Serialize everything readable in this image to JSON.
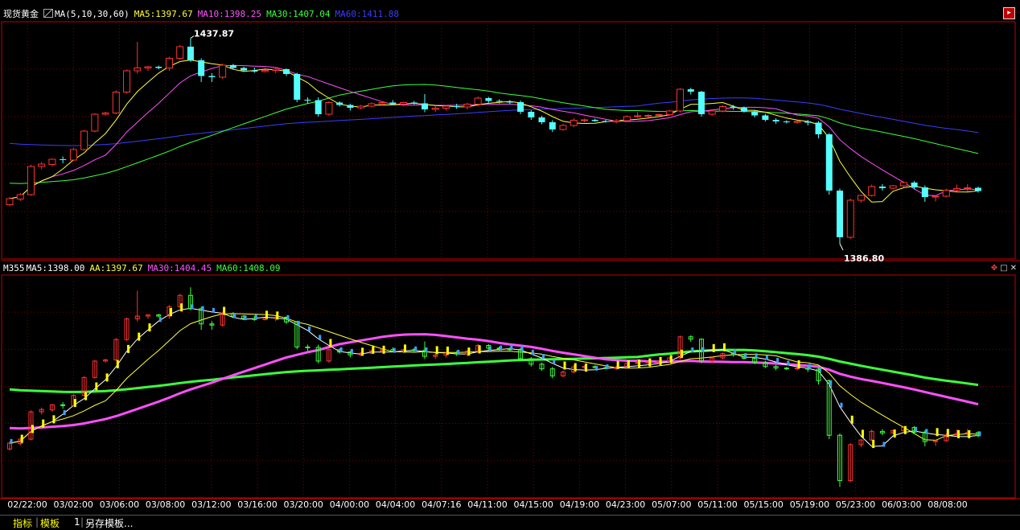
{
  "header": {
    "symbol": "现货黄金",
    "indicator": "MA(5,10,30,60)",
    "ma5": "MA5:1397.67",
    "ma10": "MA10:1398.25",
    "ma30": "MA30:1407.04",
    "ma60": "MA60:1411.88"
  },
  "sub_header": {
    "name": "M355",
    "ma5": "MA5:1398.00",
    "aa": "AA:1397.67",
    "ma30": "MA30:1404.45",
    "ma60": "MA60:1408.09"
  },
  "bottom_bar": {
    "tab1": "指标",
    "tab2": "模板",
    "num": "1",
    "save": "另存模板..."
  },
  "colors": {
    "up": "#ff3232",
    "down": "#54ffff",
    "ma5": "#ffff3c",
    "ma10": "#ff50ff",
    "ma30": "#3cff3c",
    "ma60": "#3c3cff",
    "grid": "#800000",
    "axis": "#c00000"
  },
  "chart_data": [
    {
      "type": "candlestick",
      "title": "",
      "annotations": [
        {
          "label": "1437.87",
          "value": 1437.87
        },
        {
          "label": "1386.80",
          "value": 1386.8
        }
      ],
      "x_ticks": [
        "02/22:00",
        "03/02:00",
        "03/06:00",
        "03/08:00",
        "03/12:00",
        "03/16:00",
        "03/20:00",
        "04/00:00",
        "04/04:00",
        "04/07:16",
        "04/11:00",
        "04/15:00",
        "04/19:00",
        "04/23:00",
        "05/07:00",
        "05/11:00",
        "05/15:00",
        "05/19:00",
        "05/23:00",
        "06/03:00",
        "08/08:00"
      ],
      "ylim": [
        1383,
        1442
      ],
      "candles": [
        [
          1396.5,
          1398.4,
          1396.1,
          1398.0
        ],
        [
          1397.9,
          1399.4,
          1397.4,
          1399.0
        ],
        [
          1399.0,
          1406.4,
          1398.7,
          1406.0
        ],
        [
          1406.0,
          1407.1,
          1405.3,
          1406.6
        ],
        [
          1406.5,
          1408.0,
          1406.0,
          1407.8
        ],
        [
          1407.8,
          1408.5,
          1406.8,
          1407.6
        ],
        [
          1407.6,
          1410.6,
          1407.4,
          1410.2
        ],
        [
          1410.2,
          1415.1,
          1410.0,
          1414.8
        ],
        [
          1414.8,
          1419.2,
          1414.5,
          1419.0
        ],
        [
          1419.0,
          1419.6,
          1418.6,
          1419.3
        ],
        [
          1419.3,
          1424.9,
          1419.0,
          1424.5
        ],
        [
          1424.5,
          1430.1,
          1424.1,
          1429.8
        ],
        [
          1429.8,
          1437.0,
          1429.1,
          1430.5
        ],
        [
          1430.5,
          1431.0,
          1429.8,
          1430.8
        ],
        [
          1430.8,
          1431.1,
          1430.2,
          1430.5
        ],
        [
          1430.5,
          1433.3,
          1429.8,
          1432.9
        ],
        [
          1432.9,
          1436.2,
          1432.5,
          1435.8
        ],
        [
          1435.8,
          1437.87,
          1432.0,
          1432.4
        ],
        [
          1432.4,
          1432.9,
          1427.0,
          1428.5
        ],
        [
          1428.5,
          1429.2,
          1427.0,
          1428.2
        ],
        [
          1428.2,
          1431.6,
          1427.8,
          1431.2
        ],
        [
          1431.2,
          1431.5,
          1430.1,
          1430.5
        ],
        [
          1430.5,
          1430.8,
          1429.5,
          1429.9
        ],
        [
          1429.9,
          1430.6,
          1429.3,
          1429.6
        ],
        [
          1429.6,
          1430.1,
          1429.4,
          1429.9
        ],
        [
          1429.9,
          1430.5,
          1429.2,
          1430.2
        ],
        [
          1430.2,
          1430.4,
          1428.5,
          1429.0
        ],
        [
          1429.0,
          1429.3,
          1422.0,
          1422.6
        ],
        [
          1422.6,
          1423.2,
          1421.6,
          1422.5
        ],
        [
          1422.5,
          1423.2,
          1418.4,
          1419.0
        ],
        [
          1419.0,
          1422.2,
          1418.6,
          1421.9
        ],
        [
          1421.9,
          1422.2,
          1420.9,
          1421.3
        ],
        [
          1421.3,
          1421.6,
          1419.9,
          1420.6
        ],
        [
          1420.6,
          1421.3,
          1420.2,
          1421.0
        ],
        [
          1421.0,
          1421.9,
          1420.7,
          1421.6
        ],
        [
          1421.6,
          1422.2,
          1421.1,
          1421.9
        ],
        [
          1421.9,
          1422.5,
          1421.3,
          1421.5
        ],
        [
          1421.5,
          1422.1,
          1421.0,
          1421.9
        ],
        [
          1421.9,
          1422.3,
          1421.4,
          1421.7
        ],
        [
          1421.7,
          1424.0,
          1419.5,
          1420.2
        ],
        [
          1420.2,
          1421.0,
          1419.6,
          1420.5
        ],
        [
          1420.5,
          1421.3,
          1419.9,
          1421.0
        ],
        [
          1421.0,
          1421.6,
          1420.3,
          1420.8
        ],
        [
          1420.8,
          1421.8,
          1420.2,
          1421.5
        ],
        [
          1421.5,
          1423.4,
          1421.0,
          1423.0
        ],
        [
          1423.0,
          1423.3,
          1421.9,
          1422.3
        ],
        [
          1422.3,
          1422.7,
          1421.7,
          1422.1
        ],
        [
          1422.1,
          1422.5,
          1421.6,
          1422.0
        ],
        [
          1422.0,
          1422.4,
          1419.0,
          1419.6
        ],
        [
          1419.6,
          1420.0,
          1417.6,
          1418.2
        ],
        [
          1418.2,
          1418.6,
          1416.5,
          1417.0
        ],
        [
          1417.0,
          1417.5,
          1414.6,
          1415.2
        ],
        [
          1415.2,
          1416.6,
          1414.9,
          1416.2
        ],
        [
          1416.2,
          1418.0,
          1415.8,
          1417.5
        ],
        [
          1417.5,
          1417.9,
          1417.0,
          1417.6
        ],
        [
          1417.6,
          1417.9,
          1417.1,
          1417.3
        ],
        [
          1417.3,
          1417.6,
          1416.9,
          1417.1
        ],
        [
          1417.1,
          1417.8,
          1416.7,
          1417.4
        ],
        [
          1417.4,
          1418.7,
          1417.2,
          1418.4
        ],
        [
          1418.4,
          1419.5,
          1418.1,
          1418.6
        ],
        [
          1418.6,
          1419.0,
          1418.2,
          1418.7
        ],
        [
          1418.7,
          1419.1,
          1418.4,
          1418.9
        ],
        [
          1418.9,
          1420.1,
          1418.6,
          1419.8
        ],
        [
          1419.8,
          1425.5,
          1419.4,
          1425.2
        ],
        [
          1425.2,
          1425.6,
          1423.9,
          1424.6
        ],
        [
          1424.6,
          1424.8,
          1418.4,
          1419.0
        ],
        [
          1419.0,
          1420.2,
          1418.6,
          1419.8
        ],
        [
          1419.8,
          1421.2,
          1419.5,
          1420.9
        ],
        [
          1420.9,
          1421.3,
          1420.1,
          1420.6
        ],
        [
          1420.6,
          1420.9,
          1419.4,
          1419.7
        ],
        [
          1419.7,
          1420.1,
          1418.2,
          1418.7
        ],
        [
          1418.7,
          1419.1,
          1417.2,
          1417.6
        ],
        [
          1417.6,
          1418.0,
          1416.6,
          1417.2
        ],
        [
          1417.2,
          1417.5,
          1416.7,
          1417.0
        ],
        [
          1417.0,
          1417.5,
          1416.6,
          1417.2
        ],
        [
          1417.2,
          1417.6,
          1416.2,
          1416.9
        ],
        [
          1416.9,
          1417.3,
          1413.0,
          1414.0
        ],
        [
          1414.0,
          1414.3,
          1399.0,
          1400.0
        ],
        [
          1400.0,
          1400.5,
          1386.8,
          1388.4
        ],
        [
          1388.4,
          1398.0,
          1388.0,
          1397.6
        ],
        [
          1397.6,
          1399.0,
          1397.0,
          1398.8
        ],
        [
          1398.8,
          1401.5,
          1398.5,
          1401.0
        ],
        [
          1401.0,
          1401.6,
          1400.0,
          1400.6
        ],
        [
          1400.6,
          1401.4,
          1400.3,
          1401.2
        ],
        [
          1401.2,
          1402.3,
          1400.9,
          1402.0
        ],
        [
          1402.0,
          1402.4,
          1400.3,
          1400.8
        ],
        [
          1400.8,
          1401.3,
          1397.2,
          1398.4
        ],
        [
          1398.4,
          1398.8,
          1397.3,
          1398.6
        ],
        [
          1398.6,
          1400.5,
          1398.3,
          1400.1
        ],
        [
          1400.1,
          1401.5,
          1399.8,
          1400.5
        ],
        [
          1400.5,
          1401.6,
          1399.8,
          1400.7
        ],
        [
          1400.7,
          1401.0,
          1399.5,
          1399.9
        ]
      ]
    },
    {
      "type": "candlestick",
      "title": "",
      "x_ticks": [
        "02/22:00",
        "03/02:00",
        "03/06:00",
        "03/08:00",
        "03/12:00",
        "03/16:00",
        "03/20:00",
        "04/00:00",
        "04/04:00",
        "04/07:16",
        "04/11:00",
        "04/15:00",
        "04/19:00",
        "04/23:00",
        "05/07:00",
        "05/11:00",
        "05/15:00",
        "05/19:00",
        "05/23:00",
        "06/03:00",
        "08/08:00"
      ]
    }
  ]
}
